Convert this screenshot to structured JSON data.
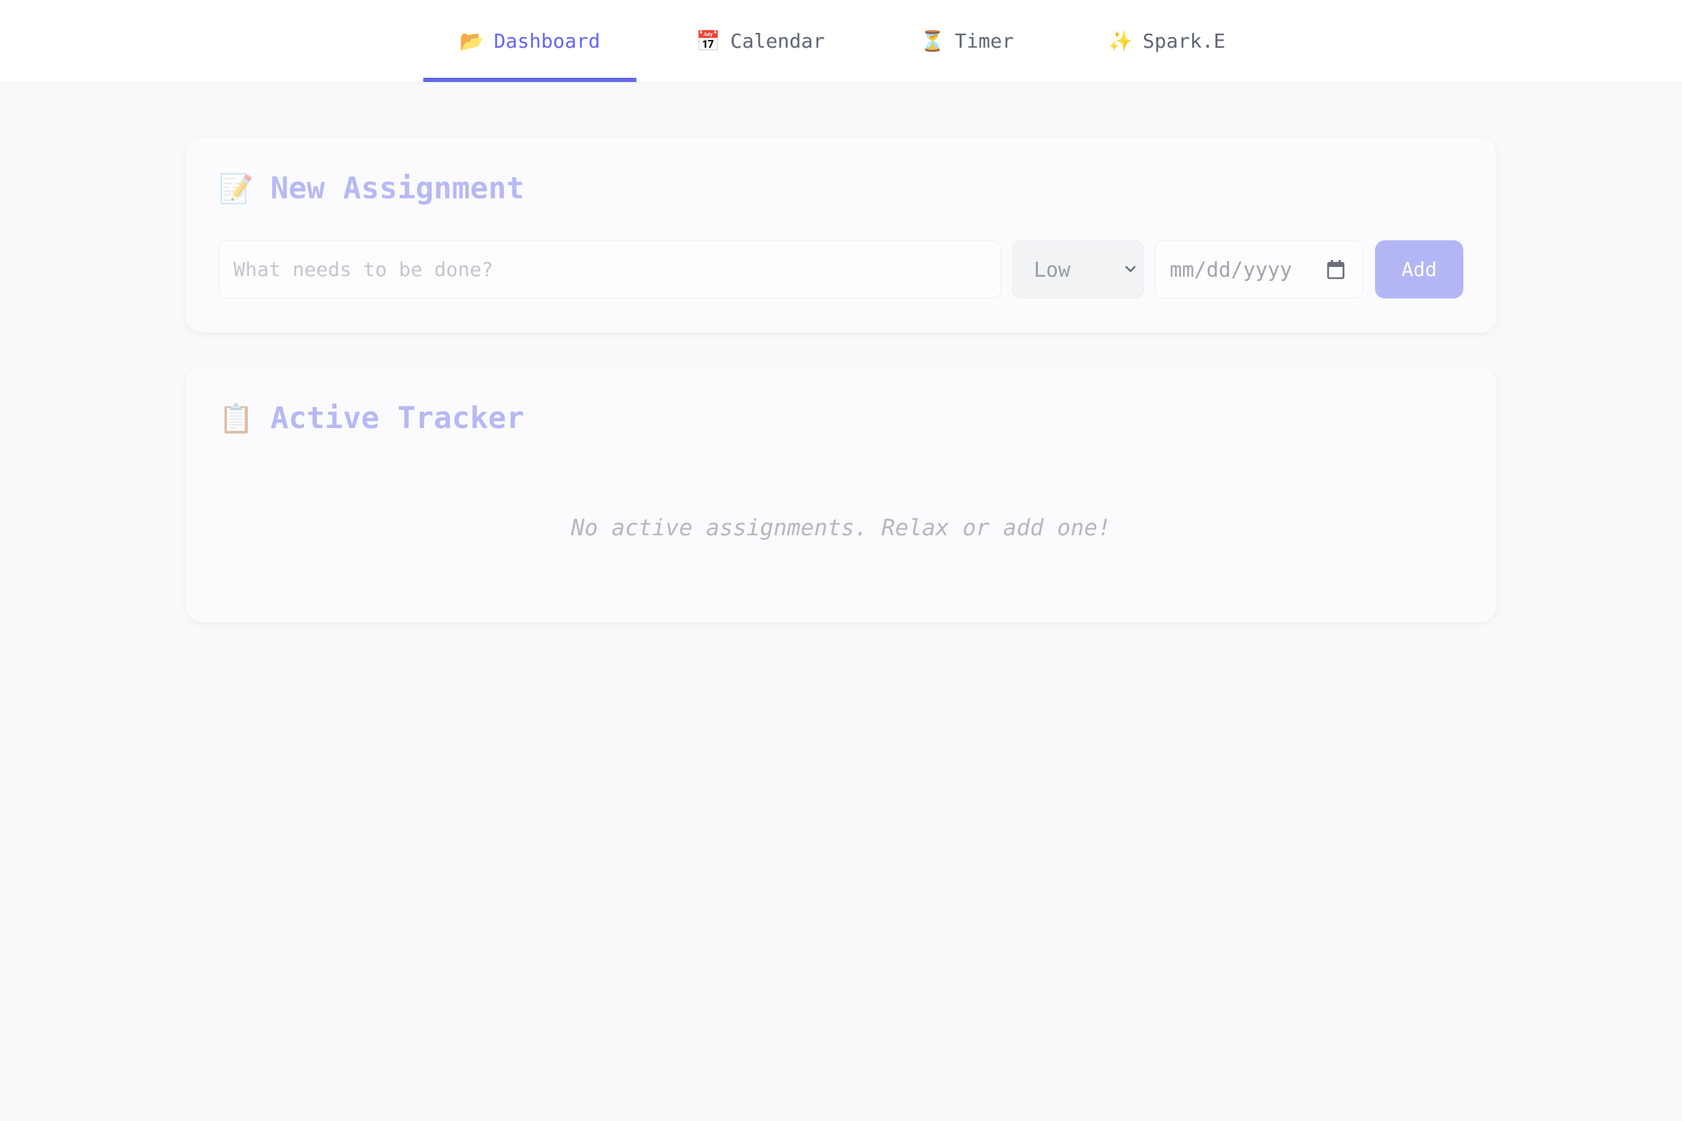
{
  "nav": {
    "tabs": [
      {
        "icon": "open-folder-icon",
        "emoji": "📂",
        "label": "Dashboard",
        "active": true
      },
      {
        "icon": "calendar-icon",
        "emoji": "📅",
        "label": "Calendar",
        "active": false
      },
      {
        "icon": "hourglass-icon",
        "emoji": "⏳",
        "label": "Timer",
        "active": false
      },
      {
        "icon": "sparkles-icon",
        "emoji": "✨",
        "label": "Spark.E",
        "active": false
      }
    ]
  },
  "new_assignment": {
    "icon": "memo-icon",
    "emoji": "📝",
    "title": "New Assignment",
    "task_input": {
      "placeholder": "What needs to be done?",
      "value": ""
    },
    "priority": {
      "selected": "Low"
    },
    "due_date": {
      "placeholder": "mm/dd/yyyy"
    },
    "add_label": "Add"
  },
  "tracker": {
    "icon": "clipboard-icon",
    "emoji": "📋",
    "title": "Active Tracker",
    "empty_message": "No active assignments. Relax or add one!"
  },
  "colors": {
    "accent": "#6366f1",
    "accent_faded": "#b4b5f4",
    "background": "#f8f9fa"
  }
}
